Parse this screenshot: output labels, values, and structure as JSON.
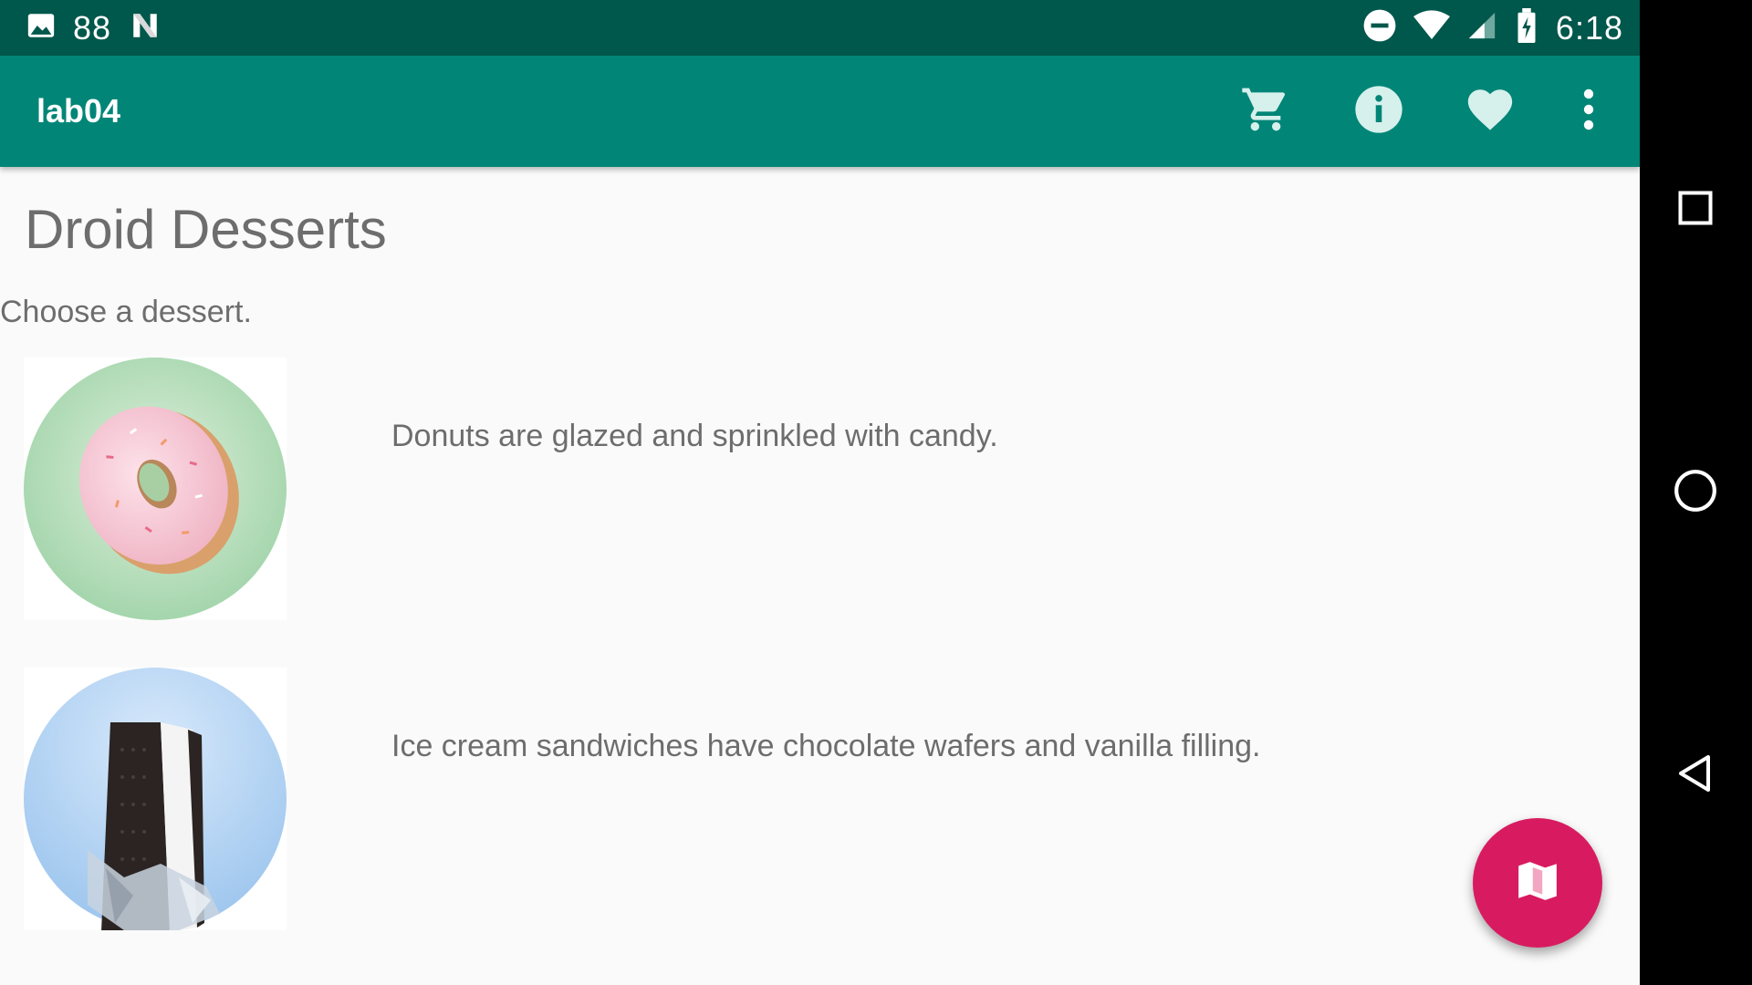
{
  "status_bar": {
    "notification_count": "88",
    "time": "6:18",
    "icons": [
      "image-icon",
      "n-icon",
      "do-not-disturb-icon",
      "wifi-icon",
      "cellular-signal-icon",
      "battery-charging-icon"
    ]
  },
  "app_bar": {
    "title": "lab04",
    "actions": [
      "cart-icon",
      "info-icon",
      "heart-icon",
      "overflow-menu-icon"
    ]
  },
  "main": {
    "title": "Droid Desserts",
    "subtitle": "Choose a dessert.",
    "desserts": [
      {
        "image": "donut-image",
        "description": "Donuts are glazed and sprinkled with candy."
      },
      {
        "image": "ice-cream-sandwich-image",
        "description": "Ice cream sandwiches have chocolate wafers and vanilla filling."
      }
    ]
  },
  "fab": {
    "icon": "map-icon"
  },
  "nav_bar": {
    "icons": [
      "recents-square-icon",
      "home-circle-icon",
      "back-triangle-icon"
    ]
  },
  "colors": {
    "status_bar": "#00574b",
    "app_bar": "#008577",
    "fab": "#d81b60",
    "background": "#fafafa",
    "text": "#6d6d6d"
  }
}
